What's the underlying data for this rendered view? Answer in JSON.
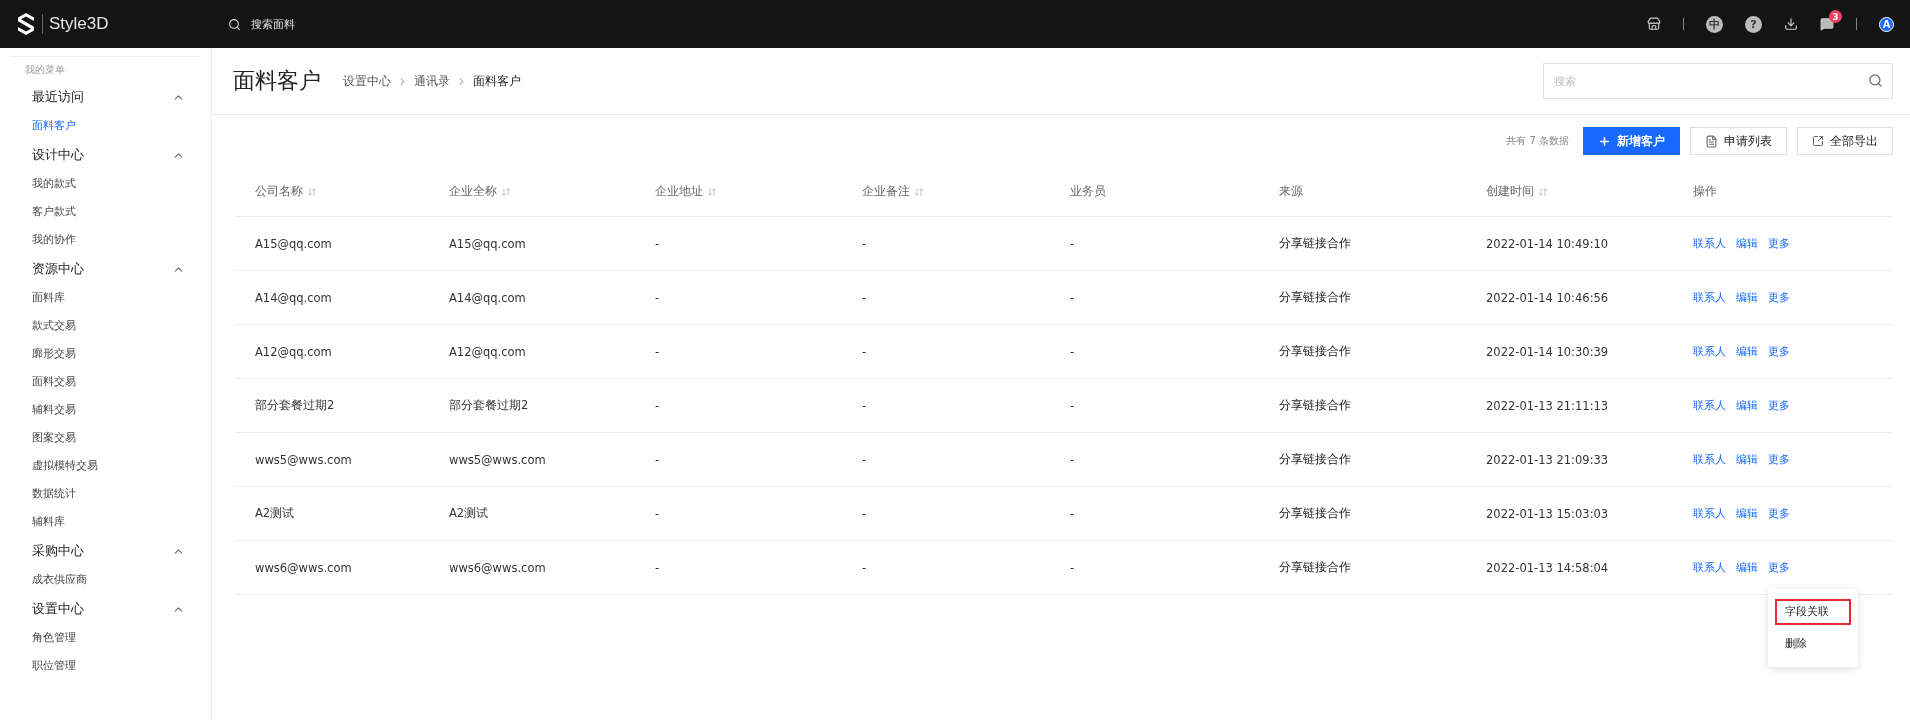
{
  "topbar": {
    "logo_text": "Style3D",
    "search_placeholder": "搜索面料",
    "language": "中",
    "help": "?",
    "notification_count": "3",
    "avatar": "A"
  },
  "sidebar": {
    "heading": "我的菜单",
    "groups": [
      {
        "label": "最近访问",
        "expanded": true,
        "items": [
          {
            "label": "面料客户",
            "selected": true
          }
        ]
      },
      {
        "label": "设计中心",
        "expanded": true,
        "items": [
          {
            "label": "我的款式",
            "selected": false
          },
          {
            "label": "客户款式",
            "selected": false
          },
          {
            "label": "我的协作",
            "selected": false
          }
        ]
      },
      {
        "label": "资源中心",
        "expanded": true,
        "items": [
          {
            "label": "面料库",
            "selected": false
          },
          {
            "label": "款式交易",
            "selected": false
          },
          {
            "label": "廓形交易",
            "selected": false
          },
          {
            "label": "面料交易",
            "selected": false
          },
          {
            "label": "辅料交易",
            "selected": false
          },
          {
            "label": "图案交易",
            "selected": false
          },
          {
            "label": "虚拟模特交易",
            "selected": false
          },
          {
            "label": "数据统计",
            "selected": false
          },
          {
            "label": "辅料库",
            "selected": false
          }
        ]
      },
      {
        "label": "采购中心",
        "expanded": true,
        "items": [
          {
            "label": "成衣供应商",
            "selected": false
          }
        ]
      },
      {
        "label": "设置中心",
        "expanded": true,
        "items": [
          {
            "label": "角色管理",
            "selected": false
          },
          {
            "label": "职位管理",
            "selected": false
          }
        ]
      }
    ]
  },
  "page": {
    "title": "面料客户",
    "breadcrumb": [
      "设置中心",
      "通讯录",
      "面料客户"
    ],
    "search_placeholder": "搜索"
  },
  "toolbar": {
    "count": "共有 7 条数据",
    "buttons": [
      {
        "kind": "primary",
        "label": "新增客户"
      },
      {
        "kind": "list",
        "label": "申请列表"
      },
      {
        "kind": "export",
        "label": "全部导出"
      }
    ]
  },
  "table": {
    "columns": [
      {
        "label": "公司名称",
        "sortable": true
      },
      {
        "label": "企业全称",
        "sortable": true
      },
      {
        "label": "企业地址",
        "sortable": true
      },
      {
        "label": "企业备注",
        "sortable": true
      },
      {
        "label": "业务员",
        "sortable": false
      },
      {
        "label": "来源",
        "sortable": false
      },
      {
        "label": "创建时间",
        "sortable": true
      },
      {
        "label": "操作",
        "sortable": false
      }
    ],
    "rows": [
      {
        "cells": [
          "A15@qq.com",
          "A15@qq.com",
          "-",
          "-",
          "-",
          "分享链接合作",
          "2022-01-14 10:49:10"
        ],
        "actions": [
          "联系人",
          "编辑",
          "更多"
        ]
      },
      {
        "cells": [
          "A14@qq.com",
          "A14@qq.com",
          "-",
          "-",
          "-",
          "分享链接合作",
          "2022-01-14 10:46:56"
        ],
        "actions": [
          "联系人",
          "编辑",
          "更多"
        ]
      },
      {
        "cells": [
          "A12@qq.com",
          "A12@qq.com",
          "-",
          "-",
          "-",
          "分享链接合作",
          "2022-01-14 10:30:39"
        ],
        "actions": [
          "联系人",
          "编辑",
          "更多"
        ]
      },
      {
        "cells": [
          "部分套餐过期2",
          "部分套餐过期2",
          "-",
          "-",
          "-",
          "分享链接合作",
          "2022-01-13 21:11:13"
        ],
        "actions": [
          "联系人",
          "编辑",
          "更多"
        ]
      },
      {
        "cells": [
          "wws5@wws.com",
          "wws5@wws.com",
          "-",
          "-",
          "-",
          "分享链接合作",
          "2022-01-13 21:09:33"
        ],
        "actions": [
          "联系人",
          "编辑",
          "更多"
        ]
      },
      {
        "cells": [
          "A2测试",
          "A2测试",
          "-",
          "-",
          "-",
          "分享链接合作",
          "2022-01-13 15:03:03"
        ],
        "actions": [
          "联系人",
          "编辑",
          "更多"
        ]
      },
      {
        "cells": [
          "wws6@wws.com",
          "wws6@wws.com",
          "-",
          "-",
          "-",
          "分享链接合作",
          "2022-01-13 14:58:04"
        ],
        "actions": [
          "联系人",
          "编辑",
          "更多"
        ],
        "menu": [
          {
            "label": "字段关联",
            "highlighted": true
          },
          {
            "label": "删除",
            "highlighted": false
          }
        ]
      }
    ]
  }
}
